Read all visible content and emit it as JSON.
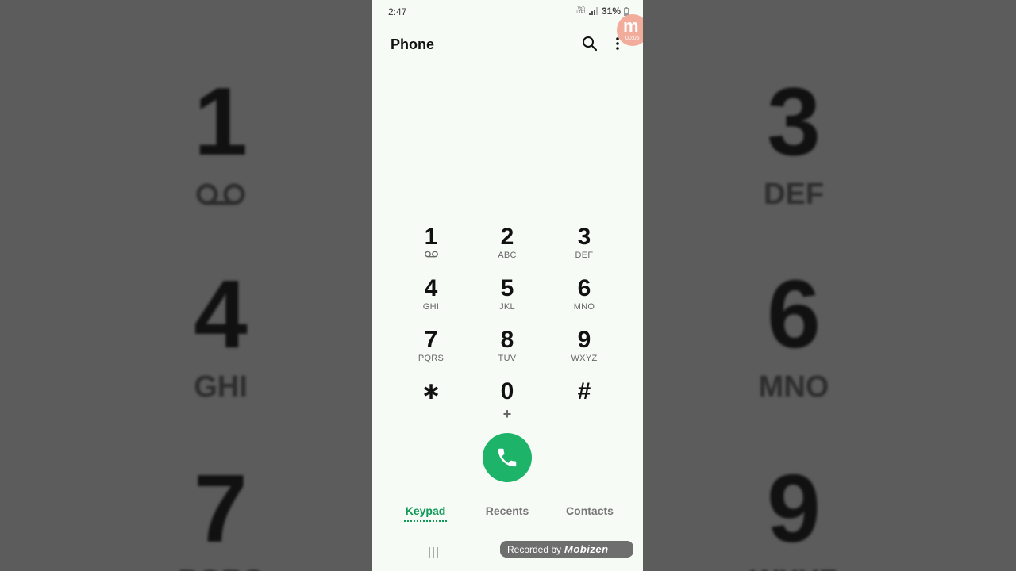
{
  "status_bar": {
    "time": "2:47",
    "network": "VoLTE LTE1",
    "battery": "31%"
  },
  "app_bar": {
    "title": "Phone"
  },
  "recorder": {
    "badge_letter": "m",
    "elapsed": "00:05"
  },
  "keypad": {
    "keys": [
      {
        "digit": "1",
        "sub": "",
        "icon": "voicemail-icon"
      },
      {
        "digit": "2",
        "sub": "ABC"
      },
      {
        "digit": "3",
        "sub": "DEF"
      },
      {
        "digit": "4",
        "sub": "GHI"
      },
      {
        "digit": "5",
        "sub": "JKL"
      },
      {
        "digit": "6",
        "sub": "MNO"
      },
      {
        "digit": "7",
        "sub": "PQRS"
      },
      {
        "digit": "8",
        "sub": "TUV"
      },
      {
        "digit": "9",
        "sub": "WXYZ"
      },
      {
        "digit": "∗",
        "sub": ""
      },
      {
        "digit": "0",
        "sub": "+"
      },
      {
        "digit": "#",
        "sub": ""
      }
    ]
  },
  "call_button": {
    "icon": "phone-icon",
    "color": "#1db46a"
  },
  "tabs": [
    {
      "label": "Keypad",
      "active": true
    },
    {
      "label": "Recents",
      "active": false
    },
    {
      "label": "Contacts",
      "active": false
    }
  ],
  "watermark": {
    "prefix": "Recorded by",
    "brand": "Mobizen"
  },
  "background_mirror": {
    "left": [
      {
        "digit": "1",
        "sub": ""
      },
      {
        "digit": "4",
        "sub": "GHI"
      },
      {
        "digit": "7",
        "sub": "PQRS"
      }
    ],
    "right": [
      {
        "digit": "3",
        "sub": "DEF"
      },
      {
        "digit": "6",
        "sub": "MNO"
      },
      {
        "digit": "9",
        "sub": "WXYZ"
      }
    ]
  },
  "colors": {
    "accent": "#0e9a56",
    "screen_bg": "#f7fbf6",
    "call_green": "#1db46a"
  }
}
